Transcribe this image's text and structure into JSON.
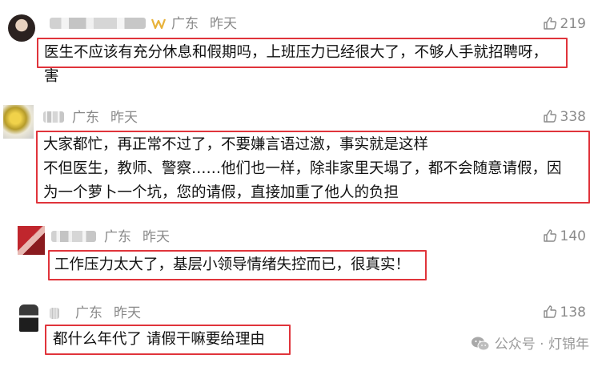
{
  "comments": [
    {
      "location": "广东",
      "time": "昨天",
      "likes": "219",
      "lines": [
        "医生不应该有充分休息和假期吗，上班压力已经很大了，不够人手就招聘呀，",
        "害"
      ]
    },
    {
      "location": "广东",
      "time": "昨天",
      "likes": "338",
      "lines": [
        "大家都忙，再正常不过了，不要嫌言语过激，事实就是这样",
        "不但医生，教师、警察……他们也一样，除非家里天塌了，都不会随意请假，因",
        "为一个萝卜一个坑，您的请假，直接加重了他人的负担"
      ]
    },
    {
      "location": "广东",
      "time": "昨天",
      "likes": "140",
      "lines": [
        "工作压力太大了，基层小领导情绪失控而已，很真实！"
      ]
    },
    {
      "location": "广东",
      "time": "昨天",
      "likes": "138",
      "lines": [
        "都什么年代了 请假干嘛要给理由"
      ]
    }
  ],
  "watermark": "公众号 · 灯锦年",
  "colors": {
    "highlight": "#e0343b",
    "meta": "#8a8a8a",
    "text": "#111111"
  }
}
